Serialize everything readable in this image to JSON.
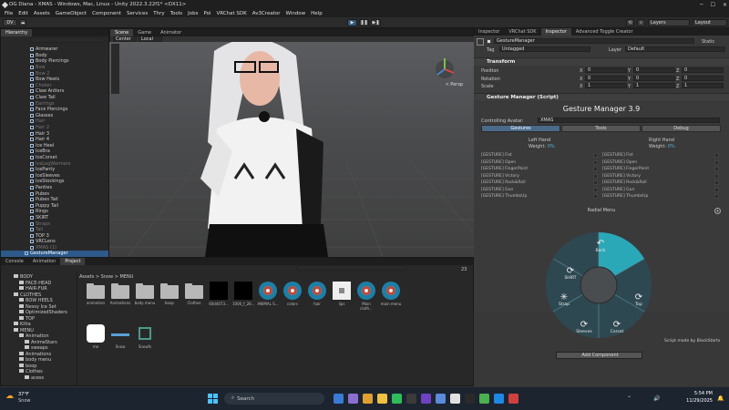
{
  "window": {
    "title": "OG Diana - XMAS - Windows, Mac, Linux - Unity 2022.3.22f1* <DX11>"
  },
  "menu": [
    "File",
    "Edit",
    "Assets",
    "GameObject",
    "Component",
    "Services",
    "Thry",
    "Tools",
    "Jobs",
    "Poi",
    "VRChat SDK",
    "Av3Creator",
    "Window",
    "Help"
  ],
  "toolbar": {
    "account": "DV",
    "layers": "Layers",
    "layout": "Layout"
  },
  "hierarchy": {
    "tab": "Hierarchy",
    "items": [
      "Armwarer",
      "Body",
      "Body Piercings",
      "Bow",
      "Bow 2",
      "Bow Heels",
      "Choker",
      "Claw Antlers",
      "Claw Tail",
      "Earrings",
      "Face Piercings",
      "Glasses",
      "Hair",
      "Hair 2",
      "Hair 3",
      "Hair 4",
      "Ice Heel",
      "IceBra",
      "IceCorset",
      "IceLegWarmers",
      "IcePanty",
      "IceSleeves",
      "IceStockings",
      "Panties",
      "Pubes",
      "Pubes Tail",
      "Puppy Tail",
      "Rings",
      "SKIRT",
      "Straps",
      "Tail",
      "TOP 3",
      "VRCLens",
      "XMAS (1)",
      "GestureManager"
    ]
  },
  "scene": {
    "tabs": [
      "Scene",
      "Game",
      "Animator"
    ],
    "pivot": "Center",
    "space": "Local",
    "persp": "< Persp"
  },
  "project": {
    "tabs": [
      "Console",
      "Animation",
      "Project"
    ],
    "breadcrumb": "Assets > Snow > MENU",
    "count": "23",
    "tree": [
      "BODY",
      "FACE-HEAD",
      "HAIR-FUR",
      "CLOTHES",
      "BOW HEELS",
      "Nessy Ice Set",
      "OptimizedShaders",
      "TOP",
      "Kitta",
      "MENU",
      "Animation",
      "AnimeStars",
      "sweaps",
      "Animations",
      "body menu",
      "boop",
      "Clothes",
      "acess"
    ],
    "assets": [
      "animation",
      "Animations",
      "body menu",
      "boop",
      "Clothes",
      "60d4073...",
      "1000_f_28...",
      "ANIMAL S...",
      "colors",
      "hair",
      "lips",
      "Main cloth...",
      "main menu",
      "me",
      "Snow",
      "Snowfs"
    ]
  },
  "inspector": {
    "tabs": [
      "Inspector",
      "VRChat SDK",
      "Inspector",
      "Advanced Toggle Creator"
    ],
    "object_name": "GestureManager",
    "static": "Static",
    "tag_label": "Tag",
    "tag": "Untagged",
    "layer_label": "Layer",
    "layer": "Default",
    "transform": "Transform",
    "position_label": "Position",
    "rotation_label": "Rotation",
    "scale_label": "Scale",
    "pos": [
      "0",
      "0",
      "0"
    ],
    "rot": [
      "0",
      "0",
      "0"
    ],
    "scale": [
      "1",
      "1",
      "1"
    ],
    "axes": [
      "X",
      "Y",
      "Z"
    ],
    "script_header": "Gesture Manager (Script)",
    "gm_title": "Gesture Manager 3.9",
    "controlling_label": "Controlling Avatar:",
    "controlling": "XMAS",
    "gm_tabs": [
      "Gestures",
      "Tools",
      "Debug"
    ],
    "left_hand": "Left Hand",
    "right_hand": "Right Hand",
    "weight_label": "Weight:",
    "weight_value": "0%",
    "gestures": [
      "[GESTURE] Fist",
      "[GESTURE] Open",
      "[GESTURE] FingerPoint",
      "[GESTURE] Victory",
      "[GESTURE] Rock&Roll",
      "[GESTURE] Gun",
      "[GESTURE] ThumbsUp"
    ],
    "radial_title": "Radial Menu",
    "radial_items": [
      "Back",
      "SHIRT",
      "Strap",
      "Sleeves",
      "Corset",
      "Top"
    ],
    "credit": "Script made by BlackStartx",
    "add_component": "Add Component"
  },
  "taskbar": {
    "temp": "37°F",
    "weather": "Snow",
    "search": "Search",
    "time": "5:54 PM",
    "date": "11/29/2025"
  },
  "colors": {
    "accent": "#2aa8b8",
    "selection": "#2d5a8a",
    "play": "#3d8fd6"
  }
}
